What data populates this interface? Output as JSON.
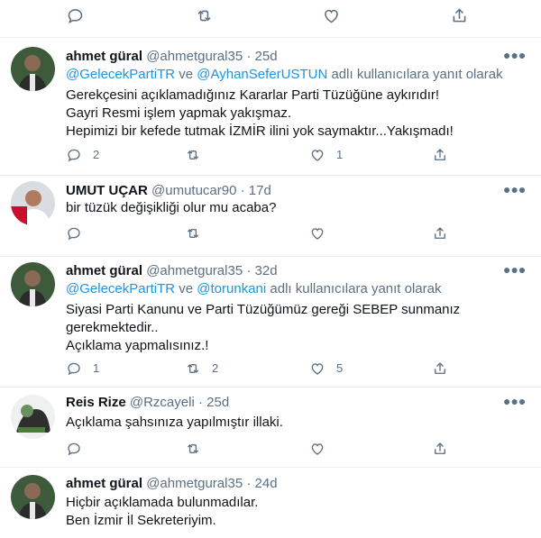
{
  "top_actions": {
    "icons": [
      "reply-icon",
      "retweet-icon",
      "like-icon",
      "share-icon"
    ]
  },
  "replying_rest": "adlı kullanıcılara yanıt olarak",
  "replying_and": "ve",
  "tweets": [
    {
      "name": "ahmet güral",
      "handle": "@ahmetgural35",
      "sep": "·",
      "time": "25d",
      "mentions": [
        "@GelecekPartiTR",
        "@AyhanSeferUSTUN"
      ],
      "lines": [
        "Gerekçesini açıklamadığınız Kararlar Parti Tüzüğüne aykırıdır!",
        "Gayri Resmi işlem yapmak yakışmaz.",
        "Hepimizi bir kefede tutmak İZMİR ilini yok saymaktır...Yakışmadı!"
      ],
      "replies": "2",
      "retweets": "",
      "likes": "1"
    },
    {
      "name": "UMUT UÇAR",
      "handle": "@umutucar90",
      "sep": "·",
      "time": "17d",
      "lines": [
        "bir tüzük değişikliği olur mu acaba?"
      ],
      "replies": "",
      "retweets": "",
      "likes": ""
    },
    {
      "name": "ahmet güral",
      "handle": "@ahmetgural35",
      "sep": "·",
      "time": "32d",
      "mentions": [
        "@GelecekPartiTR",
        "@torunkani"
      ],
      "lines": [
        "Siyasi Parti Kanunu ve Parti Tüzüğümüz gereği SEBEP sunmanız",
        "gerekmektedir..",
        "Açıklama yapmalısınız.!"
      ],
      "replies": "1",
      "retweets": "2",
      "likes": "5"
    },
    {
      "name": "Reis Rize",
      "handle": "@Rzcayeli",
      "sep": "·",
      "time": "25d",
      "lines": [
        "Açıklama şahsınıza yapılmıştır illaki."
      ],
      "replies": "",
      "retweets": "",
      "likes": ""
    },
    {
      "name": "ahmet güral",
      "handle": "@ahmetgural35",
      "sep": "·",
      "time": "24d",
      "lines": [
        "Hiçbir açıklamada bulunmadılar.",
        "Ben İzmir İl Sekreteriyim."
      ]
    }
  ],
  "colors": {
    "text": "#0f1419",
    "secondary": "#5b7083",
    "link": "#1b95e0",
    "divider": "#e6ecf0"
  }
}
